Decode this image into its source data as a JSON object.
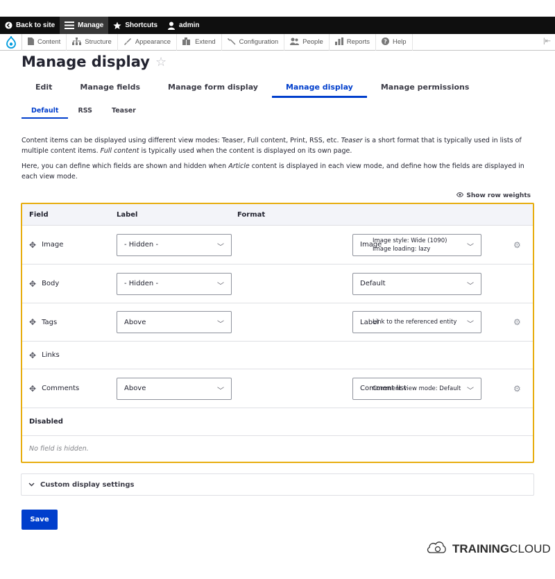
{
  "toolbar": {
    "back_label": "Back to site",
    "manage_label": "Manage",
    "shortcuts_label": "Shortcuts",
    "user_label": "admin"
  },
  "tray": {
    "items": [
      "Content",
      "Structure",
      "Appearance",
      "Extend",
      "Configuration",
      "People",
      "Reports",
      "Help"
    ]
  },
  "page": {
    "title": "Manage display",
    "star": "☆"
  },
  "primary_tabs": [
    "Edit",
    "Manage fields",
    "Manage form display",
    "Manage display",
    "Manage permissions"
  ],
  "secondary_tabs": [
    "Default",
    "RSS",
    "Teaser"
  ],
  "description": {
    "p1_a": "Content items can be displayed using different view modes: Teaser, Full content, Print, RSS, etc. ",
    "p1_em1": "Teaser",
    "p1_b": " is a short format that is typically used in lists of multiple content items. ",
    "p1_em2": "Full content",
    "p1_c": " is typically used when the content is displayed on its own page.",
    "p2_a": "Here, you can define which fields are shown and hidden when ",
    "p2_em": "Article",
    "p2_b": " content is displayed in each view mode, and define how the fields are displayed in each view mode."
  },
  "row_weights_label": "Show row weights",
  "table": {
    "headers": {
      "field": "Field",
      "label": "Label",
      "format": "Format"
    },
    "rows": [
      {
        "field": "Image",
        "label": "- Hidden -",
        "format": "Image",
        "summary1": "Image style: Wide (1090)",
        "summary2": "Image loading: lazy"
      },
      {
        "field": "Body",
        "label": "- Hidden -",
        "format": "Default",
        "summary1": "",
        "summary2": ""
      },
      {
        "field": "Tags",
        "label": "Above",
        "format": "Label",
        "summary1": "Link to the referenced entity",
        "summary2": ""
      },
      {
        "field": "Links"
      },
      {
        "field": "Comments",
        "label": "Above",
        "format": "Comment list",
        "summary1": "Comment view mode: Default",
        "summary2": ""
      }
    ],
    "disabled_label": "Disabled",
    "no_hidden_label": "No field is hidden."
  },
  "custom_settings_label": "Custom display settings",
  "save_label": "Save",
  "brand": {
    "bold": "TRAINING",
    "rest": "CLOUD"
  },
  "colors": {
    "accent": "#003ecc",
    "highlight_border": "#e7ad0e",
    "toolbar": "#0f0f0f"
  }
}
